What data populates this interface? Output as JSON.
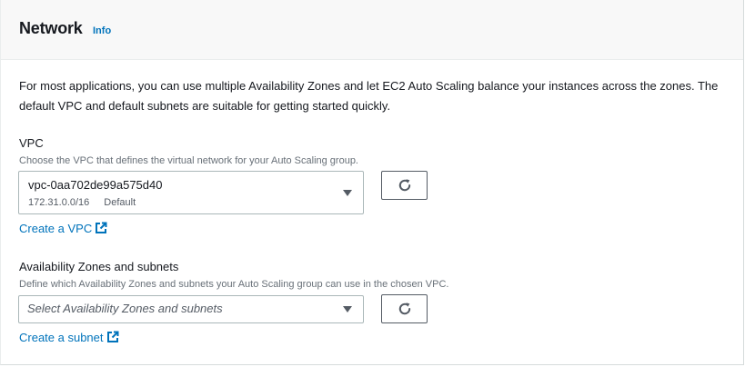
{
  "header": {
    "title": "Network",
    "info_label": "Info"
  },
  "description": "For most applications, you can use multiple Availability Zones and let EC2 Auto Scaling balance your instances across the zones. The default VPC and default subnets are suitable for getting started quickly.",
  "vpc": {
    "label": "VPC",
    "description": "Choose the VPC that defines the virtual network for your Auto Scaling group.",
    "selected_id": "vpc-0aa702de99a575d40",
    "selected_cidr": "172.31.0.0/16",
    "selected_tag": "Default",
    "create_link": "Create a VPC"
  },
  "subnets": {
    "label": "Availability Zones and subnets",
    "description": "Define which Availability Zones and subnets your Auto Scaling group can use in the chosen VPC.",
    "placeholder": "Select Availability Zones and subnets",
    "create_link": "Create a subnet"
  },
  "colors": {
    "link": "#0073bb",
    "header_bg": "#f8f8f8",
    "border": "#aab7b8"
  }
}
